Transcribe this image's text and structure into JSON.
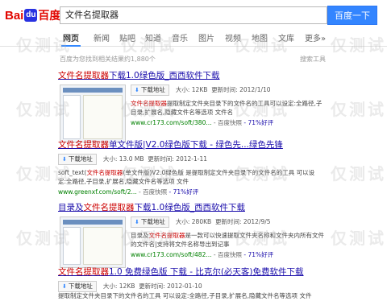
{
  "header": {
    "logo_bai": "Bai",
    "logo_du": "du",
    "logo_cn": "百度",
    "query": "文件名提取器",
    "search_button": "百度一下"
  },
  "tabs": [
    {
      "label": "网页",
      "active": true
    },
    {
      "label": "新闻"
    },
    {
      "label": "贴吧"
    },
    {
      "label": "知道"
    },
    {
      "label": "音乐"
    },
    {
      "label": "图片"
    },
    {
      "label": "视频"
    },
    {
      "label": "地图"
    },
    {
      "label": "文库"
    },
    {
      "label": "更多»"
    }
  ],
  "result_count": "百度为您找到相关结果约1,880个",
  "search_tools": "搜索工具",
  "results": [
    {
      "title_pre": "",
      "title_hl": "文件名提取器",
      "title_post": "下载1.0绿色版_西西软件下载",
      "download_label": "下载地址",
      "size": "大小: 12KB",
      "time": "更新时间: 2012/1/10",
      "desc_hl": "文件名提取器",
      "desc_rest": "提取制定文件夹目录下的文件名的工具可以设定:全路径,子目录,扩展名,隐藏文件名等选项 文件名",
      "url": "www.cr173.com/soft/380...",
      "snapshot": "- 百度快照",
      "good": "- 71%好评"
    },
    {
      "title_pre": "",
      "title_hl": "文件名提取器",
      "title_post": "单文件版|V2.0绿色版下载 - 绿色先...绿色先锋",
      "download_label": "下载地址",
      "size": "大小: 13.0 MB",
      "time": "更新时间: 2012-1-11",
      "desc_hl": "文件名提取器",
      "desc_pre": "soft_text(",
      "desc_rest": "(单文件版)V2.0绿色版 是提取制定文件夹目录下的文件名的工具 可以设定:全路径,子目录,扩展名,隐藏文件名等选项 文件",
      "url": "www.greenxf.com/soft/2...",
      "snapshot": "- 百度快照",
      "good": "- 71%好评"
    },
    {
      "title_pre": "目录及",
      "title_hl": "文件名提取器",
      "title_post": "下载1.0绿色版_西西软件下载",
      "download_label": "下载地址",
      "size": "大小: 280KB",
      "time": "更新时间: 2012/9/5",
      "desc_hl": "文件名提取器",
      "desc_pre": "目录及",
      "desc_rest": "是一款可以快速提取文件夹名称和文件夹内所有文件的文件名|支持将文件名称导出到记事",
      "url": "www.cr173.com/soft/482...",
      "snapshot": "- 百度快照",
      "good": "- 71%好评"
    },
    {
      "title_pre": "",
      "title_hl": "文件名提取器",
      "title_post": "1.0 免费绿色版 下载 - 比克尔(必天客)免费软件下载",
      "download_label": "下载地址",
      "size": "大小: 12KB",
      "time": "更新时间: 2012-01-10",
      "desc_rest": "提取制定文件夹目录下的文件名的工具 可以设定:全路径,子目录,扩展名,隐藏文件名等选项 文件",
      "url": "",
      "snapshot": "",
      "good": ""
    }
  ],
  "watermark": "仅测试"
}
